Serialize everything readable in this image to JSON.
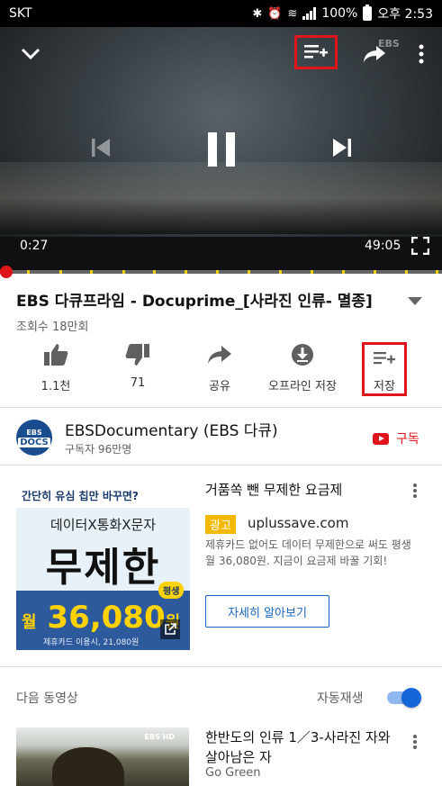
{
  "status_bar": {
    "carrier": "SKT",
    "battery": "100%",
    "time": "오후 2:53"
  },
  "player": {
    "current_time": "0:27",
    "duration": "49:05",
    "watermark": "EBS",
    "progress_fraction": 0.009
  },
  "video": {
    "title": "EBS 다큐프라임 - Docuprime_[사라진 인류- 멸종]",
    "views": "조회수 18만회"
  },
  "actions": {
    "like_count": "1.1천",
    "dislike_count": "71",
    "share_label": "공유",
    "offline_label": "오프라인 저장",
    "save_label": "저장"
  },
  "channel": {
    "logo_line1": "EBS",
    "logo_line2": "DOCS",
    "name": "EBSDocumentary (EBS 다큐)",
    "subscribers": "구독자 96만명",
    "subscribe_label": "구독"
  },
  "ad": {
    "image": {
      "headline": "간단히 유심 칩만 바꾸면?",
      "sub": "데이터X통화X문자",
      "big": "무제한",
      "pill": "평생",
      "price_prefix": "월",
      "price": "36,080",
      "price_suffix": "원",
      "fine_print": "제휴카드 이용시, 21,080원"
    },
    "title": "거품쏙 뺀 무제한 요금제",
    "badge": "광고",
    "domain": "uplussave.com",
    "description": "제휴카드 없어도 데이터 무제한으로 써도 평생 월 36,080원. 지금이 요금제 바꿀 기회!",
    "cta": "자세히 알아보기"
  },
  "up_next": {
    "label": "다음 동영상",
    "autoplay_label": "자동재생",
    "autoplay_on": true
  },
  "next_video": {
    "thumb_tag": "EBS HD",
    "title": "한반도의 인류 1／3-사라진 자와 살아남은 자",
    "channel": "Go Green"
  },
  "colors": {
    "accent_red": "#e0141b",
    "link_blue": "#1565c0",
    "toggle_blue": "#1565d8",
    "ad_badge": "#f5b800"
  }
}
